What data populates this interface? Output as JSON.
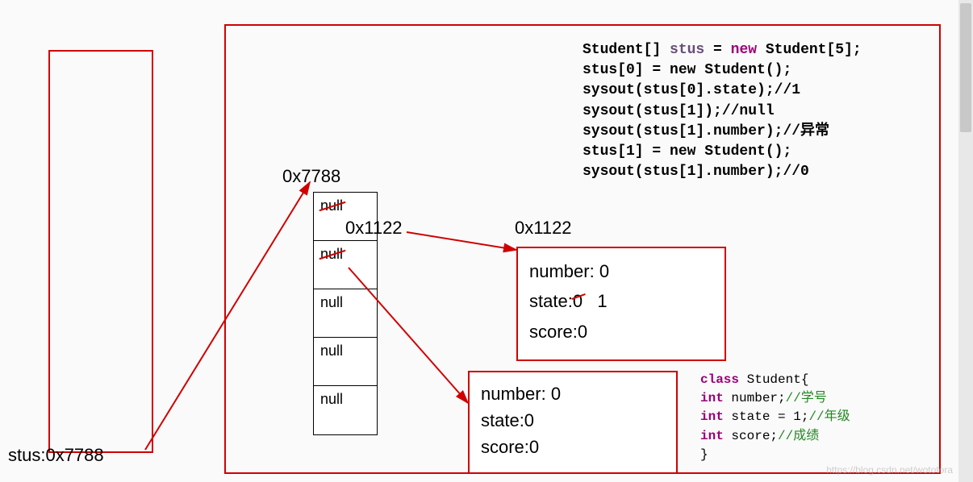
{
  "stack": {
    "label": "stus:0x7788"
  },
  "heap": {
    "arrayAddr": "0x7788",
    "addrA": "0x1122",
    "addrB": "0x1122",
    "cells": {
      "c0": "null",
      "c1": "null",
      "c2": "null",
      "c3": "null",
      "c4": "null"
    }
  },
  "obj1": {
    "line1a": "number: ",
    "line1b": "0",
    "line2a": "state:",
    "line2strike": "0",
    "line2new": "1",
    "line3a": "score:",
    "line3b": "0"
  },
  "obj2": {
    "line1": "number: 0",
    "line2": "state:0",
    "line3": "score:0"
  },
  "codeTop": {
    "l1a": "Student[] ",
    "l1var": "stus",
    "l1b": " = ",
    "l1kw": "new",
    "l1c": " Student[5];",
    "l2": "stus[0] = new Student();",
    "l3": "sysout(stus[0].state);//1",
    "l4": "sysout(stus[1]);//null",
    "l5": "sysout(stus[1].number);//异常",
    "l6": "stus[1] = new Student();",
    "l7": "sysout(stus[1].number);//0"
  },
  "codeBottom": {
    "l1a": "class",
    "l1b": " Student{",
    "l2a": "int",
    "l2b": " number;",
    "l2c": "//学号",
    "l3a": "int",
    "l3b": " state = 1;",
    "l3c": "//年级",
    "l4a": "int",
    "l4b": " score;",
    "l4c": "//成绩",
    "l5": "}"
  },
  "watermark": "https://blog.csdn.net/wototora"
}
